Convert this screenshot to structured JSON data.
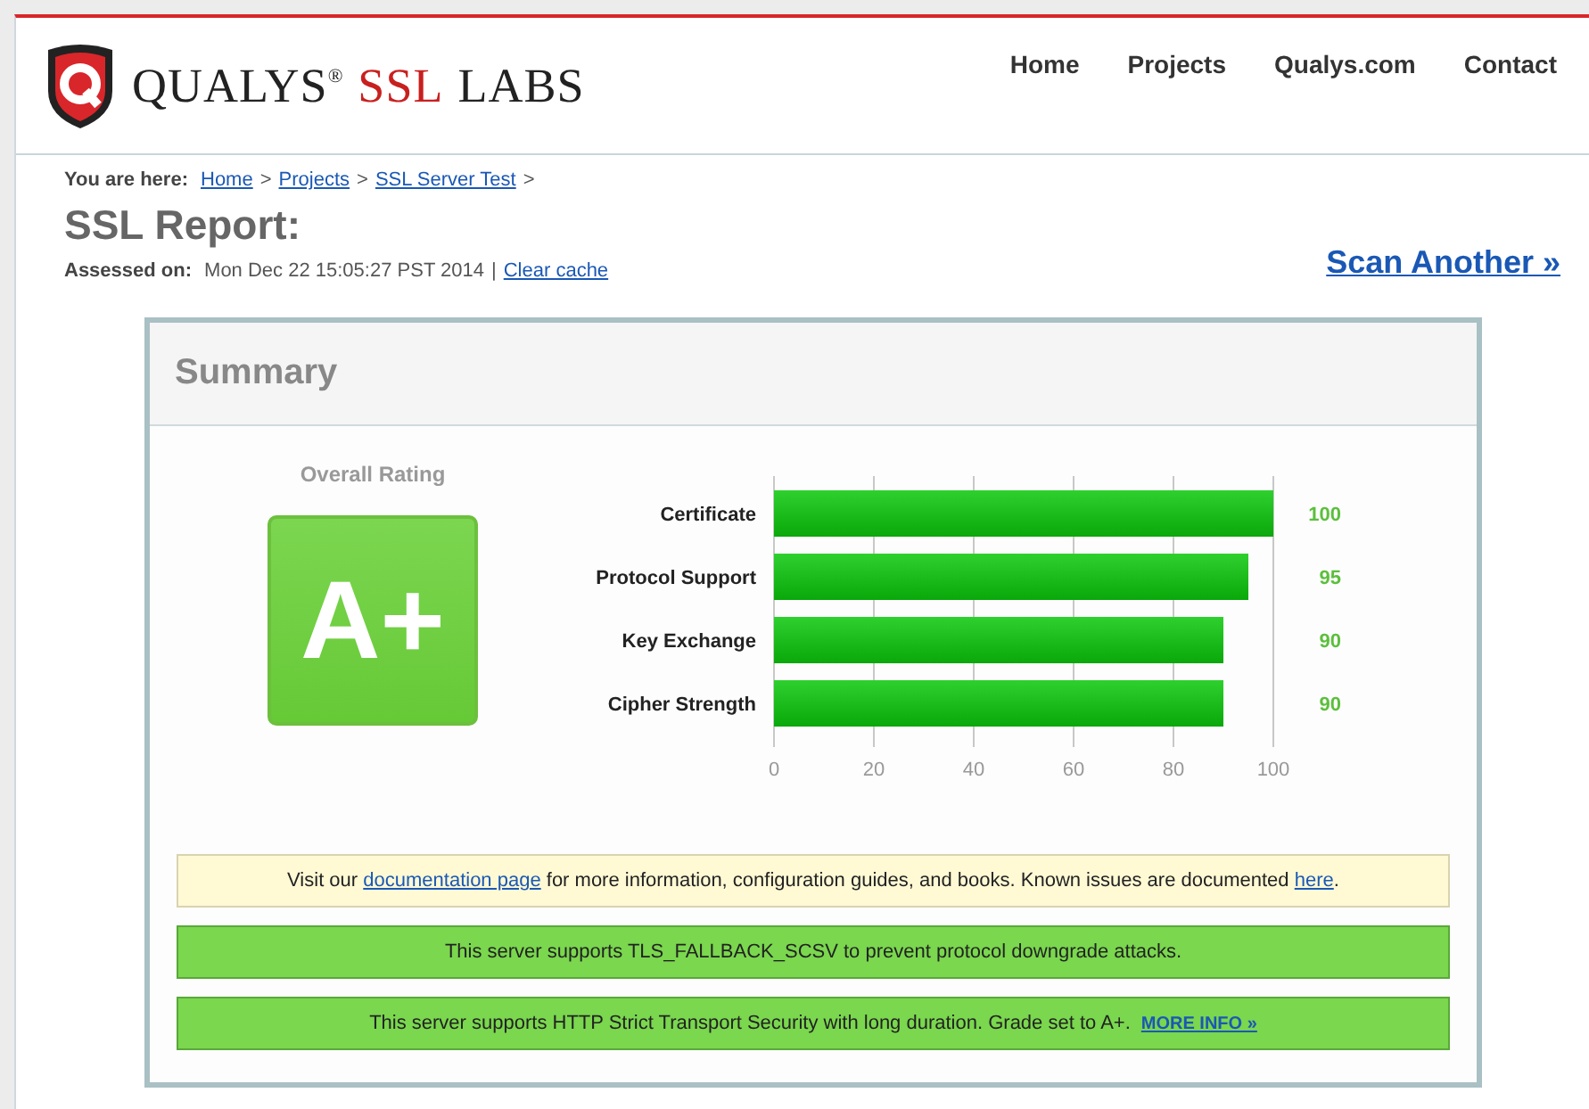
{
  "logo": {
    "brand": "QUALYS$^{®}$",
    "product": "SSL",
    "suffix": "LABS"
  },
  "nav": [
    {
      "label": "Home"
    },
    {
      "label": "Projects"
    },
    {
      "label": "Qualys.com"
    },
    {
      "label": "Contact"
    }
  ],
  "breadcrumb": {
    "label": "You are here:",
    "items": [
      {
        "label": "Home"
      },
      {
        "label": "Projects"
      },
      {
        "label": "SSL Server Test"
      }
    ],
    "separator": ">"
  },
  "title": "SSL Report:",
  "assessed": {
    "label": "Assessed on:",
    "value": "Mon Dec 22 15:05:27 PST 2014",
    "separator": "|",
    "link": "Clear cache"
  },
  "scan_another": "Scan Another »",
  "summary": {
    "title": "Summary",
    "rating_label": "Overall Rating",
    "grade": "A+",
    "chart_data": {
      "type": "bar",
      "orientation": "horizontal",
      "categories": [
        "Certificate",
        "Protocol Support",
        "Key Exchange",
        "Cipher Strength"
      ],
      "values": [
        100,
        95,
        90,
        90
      ],
      "xlim": [
        0,
        100
      ],
      "xticks": [
        0,
        20,
        40,
        60,
        80,
        100
      ],
      "grid": true,
      "value_labels": [
        "100",
        "95",
        "90",
        "90"
      ]
    },
    "notes": [
      {
        "kind": "info",
        "parts": [
          {
            "text": "Visit our "
          },
          {
            "text": "documentation page",
            "link": true
          },
          {
            "text": " for more information, configuration guides, and books. Known issues are documented "
          },
          {
            "text": "here",
            "link": true
          },
          {
            "text": "."
          }
        ]
      },
      {
        "kind": "success",
        "parts": [
          {
            "text": "This server supports TLS_FALLBACK_SCSV to prevent protocol downgrade attacks."
          }
        ]
      },
      {
        "kind": "success",
        "parts": [
          {
            "text": "This server supports HTTP Strict Transport Security with long duration. Grade set to A+."
          },
          {
            "text": "MORE INFO »",
            "link": true,
            "small": true
          }
        ]
      }
    ]
  }
}
